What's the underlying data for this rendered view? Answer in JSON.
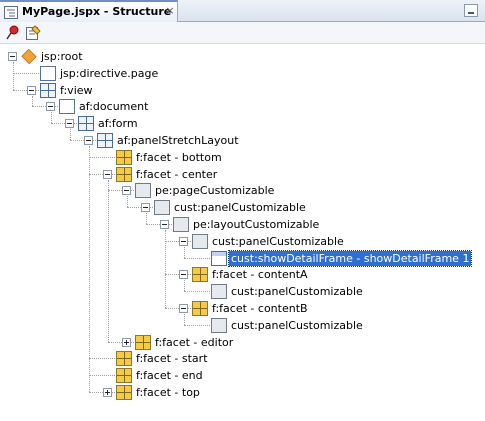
{
  "tab": {
    "title": "MyPage.jspx - Structure",
    "close": "×"
  },
  "colors": {
    "selection": "#2f6fd0",
    "facet": "#f7c948",
    "tab_accent": "#6d8fc4"
  },
  "toolbar": {
    "pin_icon": "pin-icon",
    "properties_icon": "properties-icon"
  },
  "tree": [
    {
      "label": "jsp:root",
      "icon": "jsp-root-icon",
      "depth": 0,
      "expander": "minus"
    },
    {
      "label": "jsp:directive.page",
      "icon": "directive-icon",
      "depth": 1,
      "expander": "none"
    },
    {
      "label": "f:view",
      "icon": "view-icon",
      "depth": 1,
      "expander": "minus"
    },
    {
      "label": "af:document",
      "icon": "document-icon",
      "depth": 2,
      "expander": "minus"
    },
    {
      "label": "af:form",
      "icon": "form-icon",
      "depth": 3,
      "expander": "minus"
    },
    {
      "label": "af:panelStretchLayout",
      "icon": "panel-layout-icon",
      "depth": 4,
      "expander": "minus"
    },
    {
      "label": "f:facet - bottom",
      "icon": "facet-icon",
      "depth": 5,
      "expander": "none"
    },
    {
      "label": "f:facet - center",
      "icon": "facet-icon",
      "depth": 5,
      "expander": "minus"
    },
    {
      "label": "pe:pageCustomizable",
      "icon": "customizable-icon",
      "depth": 6,
      "expander": "minus"
    },
    {
      "label": "cust:panelCustomizable",
      "icon": "customizable-icon",
      "depth": 7,
      "expander": "minus"
    },
    {
      "label": "pe:layoutCustomizable",
      "icon": "layout-customizable-icon",
      "depth": 8,
      "expander": "minus"
    },
    {
      "label": "cust:panelCustomizable",
      "icon": "customizable-icon",
      "depth": 9,
      "expander": "minus"
    },
    {
      "label": "cust:showDetailFrame - showDetailFrame 1",
      "icon": "frame-icon",
      "depth": 10,
      "expander": "none",
      "selected": true
    },
    {
      "label": "f:facet - contentA",
      "icon": "facet-icon",
      "depth": 9,
      "expander": "minus"
    },
    {
      "label": "cust:panelCustomizable",
      "icon": "customizable-icon",
      "depth": 10,
      "expander": "none"
    },
    {
      "label": "f:facet - contentB",
      "icon": "facet-icon",
      "depth": 9,
      "expander": "minus"
    },
    {
      "label": "cust:panelCustomizable",
      "icon": "customizable-icon",
      "depth": 10,
      "expander": "none"
    },
    {
      "label": "f:facet - editor",
      "icon": "facet-icon",
      "depth": 6,
      "expander": "plus"
    },
    {
      "label": "f:facet - start",
      "icon": "facet-icon",
      "depth": 5,
      "expander": "none"
    },
    {
      "label": "f:facet - end",
      "icon": "facet-icon",
      "depth": 5,
      "expander": "none"
    },
    {
      "label": "f:facet - top",
      "icon": "facet-icon",
      "depth": 5,
      "expander": "plus"
    }
  ]
}
